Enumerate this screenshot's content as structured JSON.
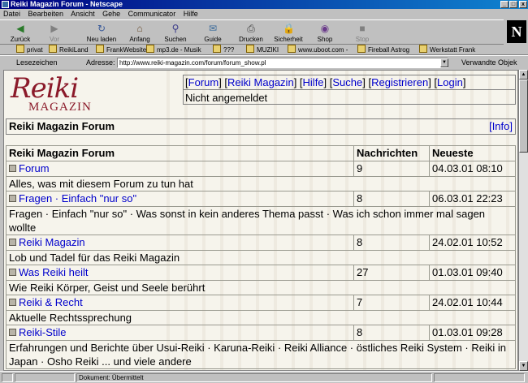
{
  "window": {
    "title": "Reiki Magazin Forum - Netscape"
  },
  "menu": [
    "Datei",
    "Bearbeiten",
    "Ansicht",
    "Gehe",
    "Communicator",
    "Hilfe"
  ],
  "toolbar": {
    "buttons": [
      "Zurück",
      "Vor",
      "Neu laden",
      "Anfang",
      "Suchen",
      "Guide",
      "Drucken",
      "Sicherheit",
      "Shop",
      "Stop"
    ]
  },
  "bookmarks": [
    "privat",
    "ReikiLand",
    "FrankWebsite",
    "mp3.de - Musik",
    "???",
    "MUZIKI",
    "www.uboot.com -",
    "Fireball Astrog",
    "Werkstatt Frank"
  ],
  "location": {
    "bookmarks_label": "Lesezeichen",
    "address_label": "Adresse:",
    "url": "http://www.reiki-magazin.com/forum/forum_show.pl",
    "related_label": "Verwandte Objek"
  },
  "logo": {
    "line1": "Reiki",
    "line2": "MAGAZIN"
  },
  "nav": {
    "links": [
      "Forum",
      "Reiki Magazin",
      "Hilfe",
      "Suche",
      "Registrieren",
      "Login"
    ],
    "login_state": "Nicht angemeldet"
  },
  "forum": {
    "title": "Reiki Magazin Forum",
    "info_link": "Info"
  },
  "table": {
    "headers": [
      "Reiki Magazin Forum",
      "Nachrichten",
      "Neueste"
    ],
    "rows": [
      {
        "name": "Forum",
        "count": "9",
        "latest": "04.03.01 08:10",
        "desc": "Alles, was mit diesem Forum zu tun hat"
      },
      {
        "name": "Fragen · Einfach \"nur so\"",
        "count": "8",
        "latest": "06.03.01 22:23",
        "desc": "Fragen · Einfach \"nur so\" · Was sonst in kein anderes Thema passt · Was ich schon immer mal sagen wollte"
      },
      {
        "name": "Reiki Magazin",
        "count": "8",
        "latest": "24.02.01 10:52",
        "desc": "Lob und Tadel für das Reiki Magazin"
      },
      {
        "name": "Was Reiki heilt",
        "count": "27",
        "latest": "01.03.01 09:40",
        "desc": "Wie Reiki Körper, Geist und Seele berührt"
      },
      {
        "name": "Reiki & Recht",
        "count": "7",
        "latest": "24.02.01 10:44",
        "desc": "Aktuelle Rechtssprechung"
      },
      {
        "name": "Reiki-Stile",
        "count": "8",
        "latest": "01.03.01 09:28",
        "desc": "Erfahrungen und Berichte über Usui-Reiki · Karuna-Reiki · Reiki Alliance · östliches Reiki System · Reiki in Japan · Osho Reiki ... und viele andere"
      }
    ]
  },
  "status": {
    "text": "Dokument: Übermittelt"
  }
}
